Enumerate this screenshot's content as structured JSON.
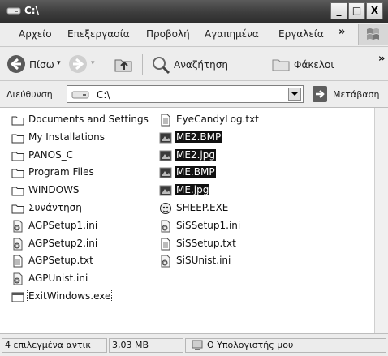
{
  "window": {
    "title": "C:\\"
  },
  "title_buttons": {
    "minimize": "_",
    "maximize": "□",
    "close": "X"
  },
  "menu": {
    "items": [
      "Αρχείο",
      "Επεξεργασία",
      "Προβολή",
      "Αγαπημένα",
      "Εργαλεία"
    ],
    "overflow": "»"
  },
  "toolbar": {
    "back_label": "Πίσω",
    "search_label": "Αναζήτηση",
    "folders_label": "Φάκελοι",
    "overflow": "»"
  },
  "address": {
    "label": "Διεύθυνση",
    "value": "C:\\",
    "go_label": "Μετάβαση"
  },
  "files": {
    "col1": [
      {
        "name": "Documents and Settings",
        "icon": "folder-icon"
      },
      {
        "name": "My Installations",
        "icon": "folder-icon"
      },
      {
        "name": "PANOS_C",
        "icon": "folder-icon"
      },
      {
        "name": "Program Files",
        "icon": "folder-icon"
      },
      {
        "name": "WINDOWS",
        "icon": "folder-icon"
      },
      {
        "name": "Συνάντηση",
        "icon": "folder-icon"
      },
      {
        "name": "AGPSetup1.ini",
        "icon": "ini-file-icon"
      },
      {
        "name": "AGPSetup2.ini",
        "icon": "ini-file-icon"
      },
      {
        "name": "AGPSetup.txt",
        "icon": "text-file-icon"
      },
      {
        "name": "AGPUnist.ini",
        "icon": "ini-file-icon"
      },
      {
        "name": "ExitWindows.exe",
        "icon": "exe-icon"
      }
    ],
    "col2": [
      {
        "name": "EyeCandyLog.txt",
        "icon": "text-file-icon"
      },
      {
        "name": "ME2.BMP",
        "icon": "image-file-icon"
      },
      {
        "name": "ME2.jpg",
        "icon": "image-file-icon"
      },
      {
        "name": "ME.BMP",
        "icon": "image-file-icon"
      },
      {
        "name": "ME.jpg",
        "icon": "image-file-icon"
      },
      {
        "name": "SHEEP.EXE",
        "icon": "sheep-exe-icon"
      },
      {
        "name": "SiSSetup1.ini",
        "icon": "ini-file-icon"
      },
      {
        "name": "SiSSetup.txt",
        "icon": "text-file-icon"
      },
      {
        "name": "SiSUnist.ini",
        "icon": "ini-file-icon"
      }
    ]
  },
  "status": {
    "selected": "4 επιλεγμένα αντικ",
    "size": "3,03 MB",
    "location": "Ο Υπολογιστής μου"
  }
}
